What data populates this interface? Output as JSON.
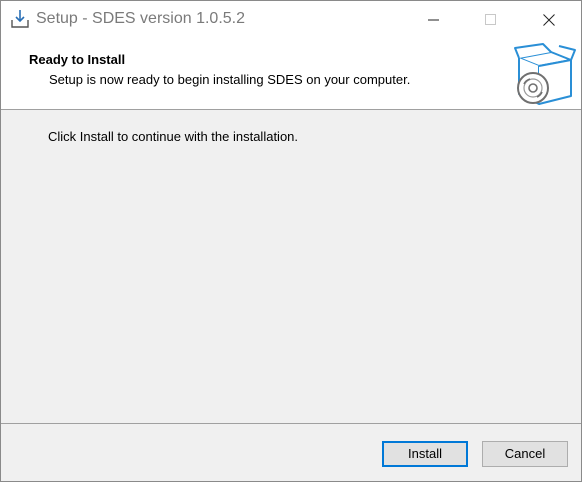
{
  "window": {
    "title": "Setup - SDES version 1.0.5.2"
  },
  "titlebar": {
    "icons": [
      "installer-download-icon",
      "minimize-icon",
      "maximize-icon",
      "close-icon"
    ]
  },
  "header": {
    "title": "Ready to Install",
    "subtitle": "Setup is now ready to begin installing SDES on your computer.",
    "icon": "box-with-disc-icon"
  },
  "main": {
    "message": "Click Install to continue with the installation."
  },
  "buttons": {
    "install_label": "Install",
    "cancel_label": "Cancel"
  },
  "colors": {
    "accent": "#0078d7",
    "icon_blue": "#2a8fd6",
    "disc_gray": "#707070"
  }
}
